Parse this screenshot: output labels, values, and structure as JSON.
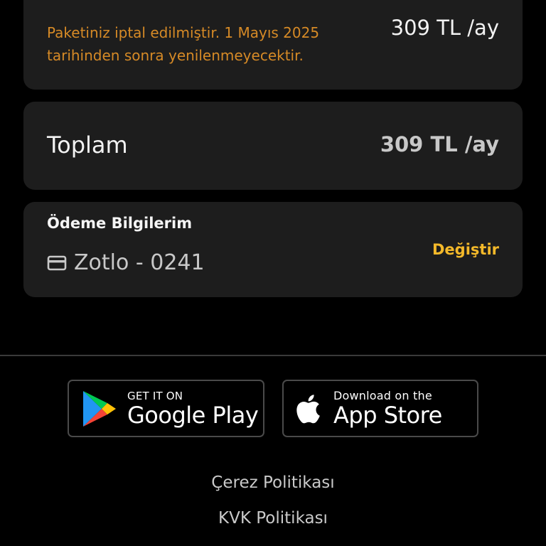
{
  "subscription": {
    "notice": "Paketiniz iptal edilmiştir. 1 Mayıs 2025 tarihinden sonra yenilenmeyecektir.",
    "price": "309 TL /ay",
    "notice_color": "#d68a26"
  },
  "total": {
    "label": "Toplam",
    "price": "309 TL /ay"
  },
  "payment": {
    "title": "Ödeme Bilgilerim",
    "method": "Zotlo - 0241",
    "method_icon": "credit-card-icon",
    "change_label": "Değiştir",
    "accent_color": "#f4b92a"
  },
  "stores": {
    "google": {
      "small": "GET IT ON",
      "big": "Google Play",
      "icon": "google-play-icon"
    },
    "apple": {
      "small": "Download on the",
      "big": "App Store",
      "icon": "apple-icon"
    }
  },
  "footer": {
    "cookie_policy": "Çerez Politikası",
    "kvk_policy": "KVK Politikası"
  }
}
